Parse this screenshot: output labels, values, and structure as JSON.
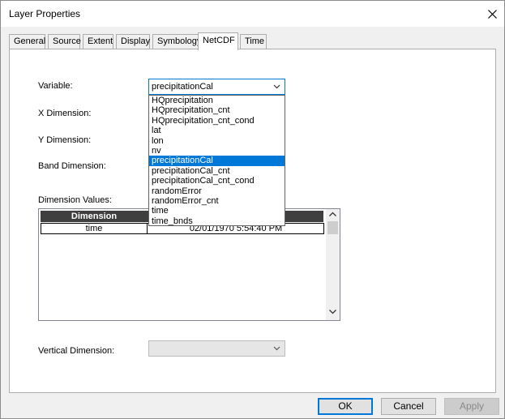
{
  "dialog": {
    "title": "Layer Properties"
  },
  "tabs": [
    {
      "label": "General"
    },
    {
      "label": "Source"
    },
    {
      "label": "Extent"
    },
    {
      "label": "Display"
    },
    {
      "label": "Symbology"
    },
    {
      "label": "NetCDF"
    },
    {
      "label": "Time"
    }
  ],
  "active_tab": "NetCDF",
  "form": {
    "variable_label": "Variable:",
    "variable_value": "precipitationCal",
    "x_dim_label": "X Dimension:",
    "y_dim_label": "Y Dimension:",
    "band_dim_label": "Band Dimension:",
    "dim_values_label": "Dimension Values:",
    "vertical_dim_label": "Vertical Dimension:",
    "vertical_dim_value": ""
  },
  "variable_options": [
    "HQprecipitation",
    "HQprecipitation_cnt",
    "HQprecipitation_cnt_cond",
    "lat",
    "lon",
    "nv",
    "precipitationCal",
    "precipitationCal_cnt",
    "precipitationCal_cnt_cond",
    "randomError",
    "randomError_cnt",
    "time",
    "time_bnds"
  ],
  "selected_option": "precipitationCal",
  "dim_table": {
    "header": "Dimension",
    "rows": [
      {
        "dimension": "time",
        "value": "02/01/1970 5:54:40 PM"
      }
    ]
  },
  "buttons": {
    "ok": "OK",
    "cancel": "Cancel",
    "apply": "Apply"
  },
  "colors": {
    "accent": "#0078d7",
    "header_bg": "#3f3f3f"
  }
}
